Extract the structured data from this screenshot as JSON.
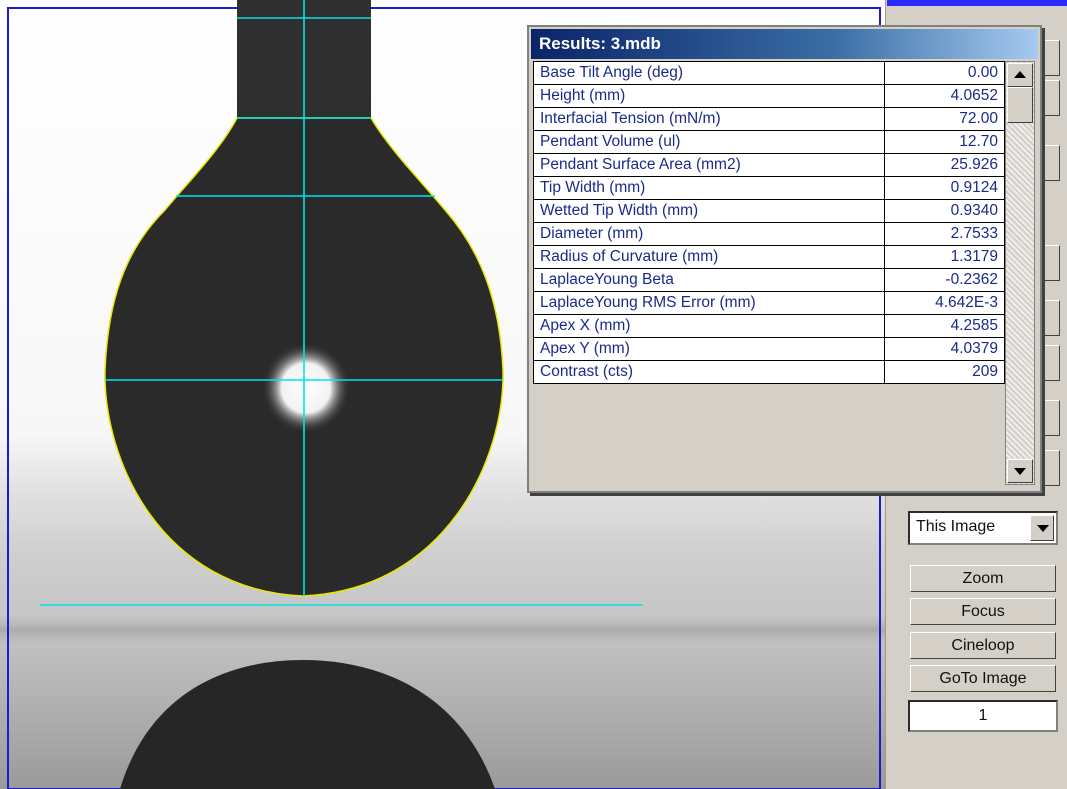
{
  "results_window": {
    "title": "Results: 3.mdb",
    "rows": [
      {
        "label": "Base Tilt Angle (deg)",
        "value": "0.00"
      },
      {
        "label": "Height (mm)",
        "value": "4.0652"
      },
      {
        "label": "Interfacial Tension (mN/m)",
        "value": "72.00"
      },
      {
        "label": "Pendant Volume (ul)",
        "value": "12.70"
      },
      {
        "label": "Pendant Surface Area (mm2)",
        "value": "25.926"
      },
      {
        "label": "Tip Width (mm)",
        "value": "0.9124"
      },
      {
        "label": "Wetted Tip Width (mm)",
        "value": "0.9340"
      },
      {
        "label": "Diameter (mm)",
        "value": "2.7533"
      },
      {
        "label": "Radius of Curvature (mm)",
        "value": "1.3179"
      },
      {
        "label": "LaplaceYoung Beta",
        "value": "-0.2362"
      },
      {
        "label": "LaplaceYoung RMS Error (mm)",
        "value": "4.642E-3"
      },
      {
        "label": "Apex X (mm)",
        "value": "4.2585"
      },
      {
        "label": "Apex Y (mm)",
        "value": "4.0379"
      },
      {
        "label": "Contrast (cts)",
        "value": "209"
      }
    ]
  },
  "controls": {
    "image_scope": "This Image",
    "buttons": [
      "Zoom",
      "Focus",
      "Cineloop",
      "GoTo Image"
    ],
    "image_number": "1"
  },
  "colors": {
    "overlay_lines": "#00e5e5",
    "drop_outline": "#e8e800",
    "title_bar": "#0a246a"
  },
  "icons": [
    "scroll-up-arrow-icon",
    "scroll-down-arrow-icon",
    "dropdown-arrow-icon"
  ]
}
